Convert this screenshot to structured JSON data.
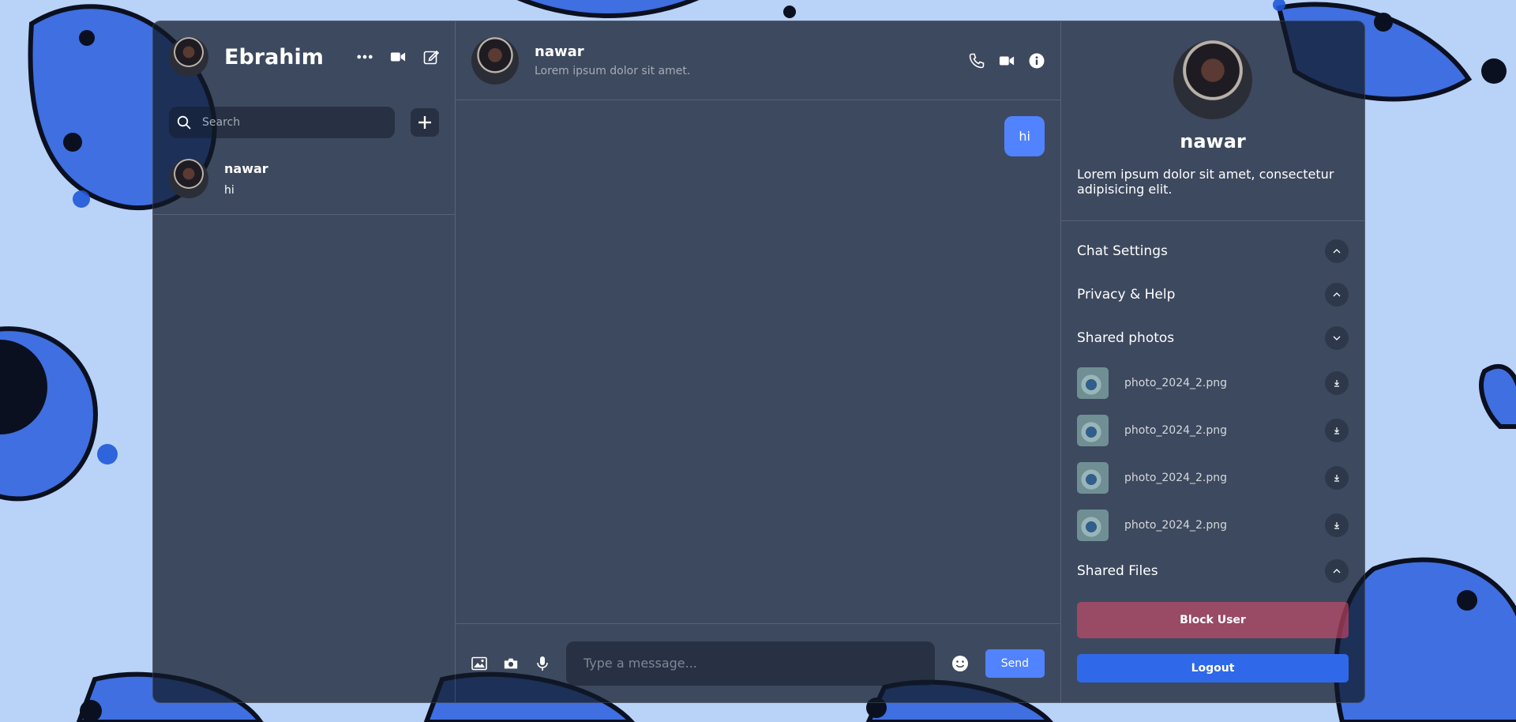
{
  "colors": {
    "accent": "#5183fe",
    "danger": "#8b4a62",
    "logout": "#2f69e9",
    "panel": "#111928"
  },
  "user": {
    "name": "Ebrahim",
    "icons": [
      "more-icon",
      "video-icon",
      "edit-icon"
    ]
  },
  "search": {
    "placeholder": "Search"
  },
  "chat_list": [
    {
      "name": "nawar",
      "last_message": "hi"
    }
  ],
  "chat": {
    "contact_name": "nawar",
    "contact_status": "Lorem ipsum dolor sit amet.",
    "messages": [
      {
        "text": "hi",
        "own": true
      }
    ],
    "input_placeholder": "Type a message...",
    "send_label": "Send"
  },
  "detail": {
    "name": "nawar",
    "bio": "Lorem ipsum dolor sit amet, consectetur adipisicing elit.",
    "options": {
      "chat_settings": "Chat Settings",
      "privacy_help": "Privacy & Help",
      "shared_photos": "Shared photos",
      "shared_files": "Shared Files"
    },
    "photos": [
      "photo_2024_2.png",
      "photo_2024_2.png",
      "photo_2024_2.png",
      "photo_2024_2.png"
    ],
    "block_label": "Block User",
    "logout_label": "Logout"
  }
}
